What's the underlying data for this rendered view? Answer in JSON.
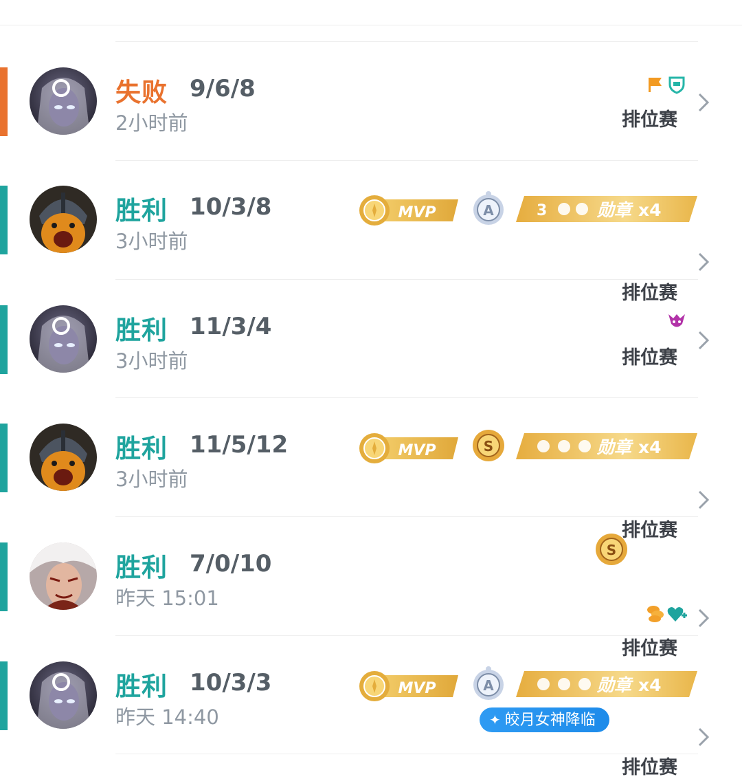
{
  "matches": [
    {
      "result": "失败",
      "kda": "9/6/8",
      "time": "2小时前",
      "mode": "排位赛"
    },
    {
      "result": "胜利",
      "kda": "10/3/8",
      "time": "3小时前",
      "mode": "排位赛",
      "grade": "A",
      "medal": {
        "label": "勋章",
        "count": "x4",
        "lead": "3"
      }
    },
    {
      "result": "胜利",
      "kda": "11/3/4",
      "time": "3小时前",
      "mode": "排位赛"
    },
    {
      "result": "胜利",
      "kda": "11/5/12",
      "time": "3小时前",
      "mode": "排位赛",
      "grade": "S",
      "medal": {
        "label": "勋章",
        "count": "x4"
      }
    },
    {
      "result": "胜利",
      "kda": "7/0/10",
      "time": "昨天 15:01",
      "mode": "排位赛",
      "grade": "S"
    },
    {
      "result": "胜利",
      "kda": "10/3/3",
      "time": "昨天 14:40",
      "mode": "排位赛",
      "grade": "A",
      "medal": {
        "label": "勋章",
        "count": "x4"
      },
      "event": "皎月女神降临"
    }
  ],
  "mvp_label": "MVP",
  "colors": {
    "win": "#1fa49e",
    "loss": "#e9722e",
    "gold": "#e8b33a",
    "event": "#1d8bea"
  },
  "icons": [
    "flag-icon",
    "shield-icon",
    "demon-icon",
    "coins-icon",
    "heart-plus-icon",
    "chevron-right-icon",
    "sparkle-icon"
  ]
}
